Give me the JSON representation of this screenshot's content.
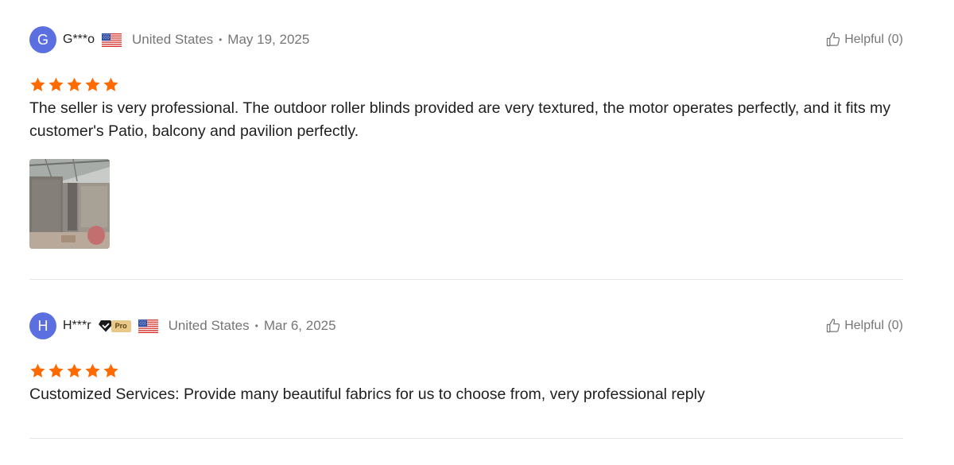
{
  "reviews": [
    {
      "initial": "G",
      "name": "G***o",
      "country": "United States",
      "separator": "•",
      "date": "May 19, 2025",
      "helpful_label": "Helpful (0)",
      "rating": 5,
      "text": "The seller is very professional. The outdoor roller blinds provided are very textured, the motor operates perfectly, and it fits my customer's Patio, balcony and pavilion perfectly.",
      "has_photo": true
    },
    {
      "initial": "H",
      "name": "H***r",
      "badge": "Pro",
      "country": "United States",
      "separator": "•",
      "date": "Mar 6, 2025",
      "helpful_label": "Helpful (0)",
      "rating": 5,
      "text": "Customized Services: Provide many beautiful fabrics for us to choose from, very professional reply",
      "has_photo": false
    }
  ],
  "colors": {
    "avatar": "#5B6FE0",
    "star": "#FF6A00",
    "muted_text": "#767676",
    "divider": "#E6E6E6",
    "pro_badge": "#E8C989"
  },
  "icons": {
    "helpful": "thumbs-up-icon",
    "flag": "us-flag-icon",
    "star": "star-icon",
    "verified": "diamond-icon"
  }
}
